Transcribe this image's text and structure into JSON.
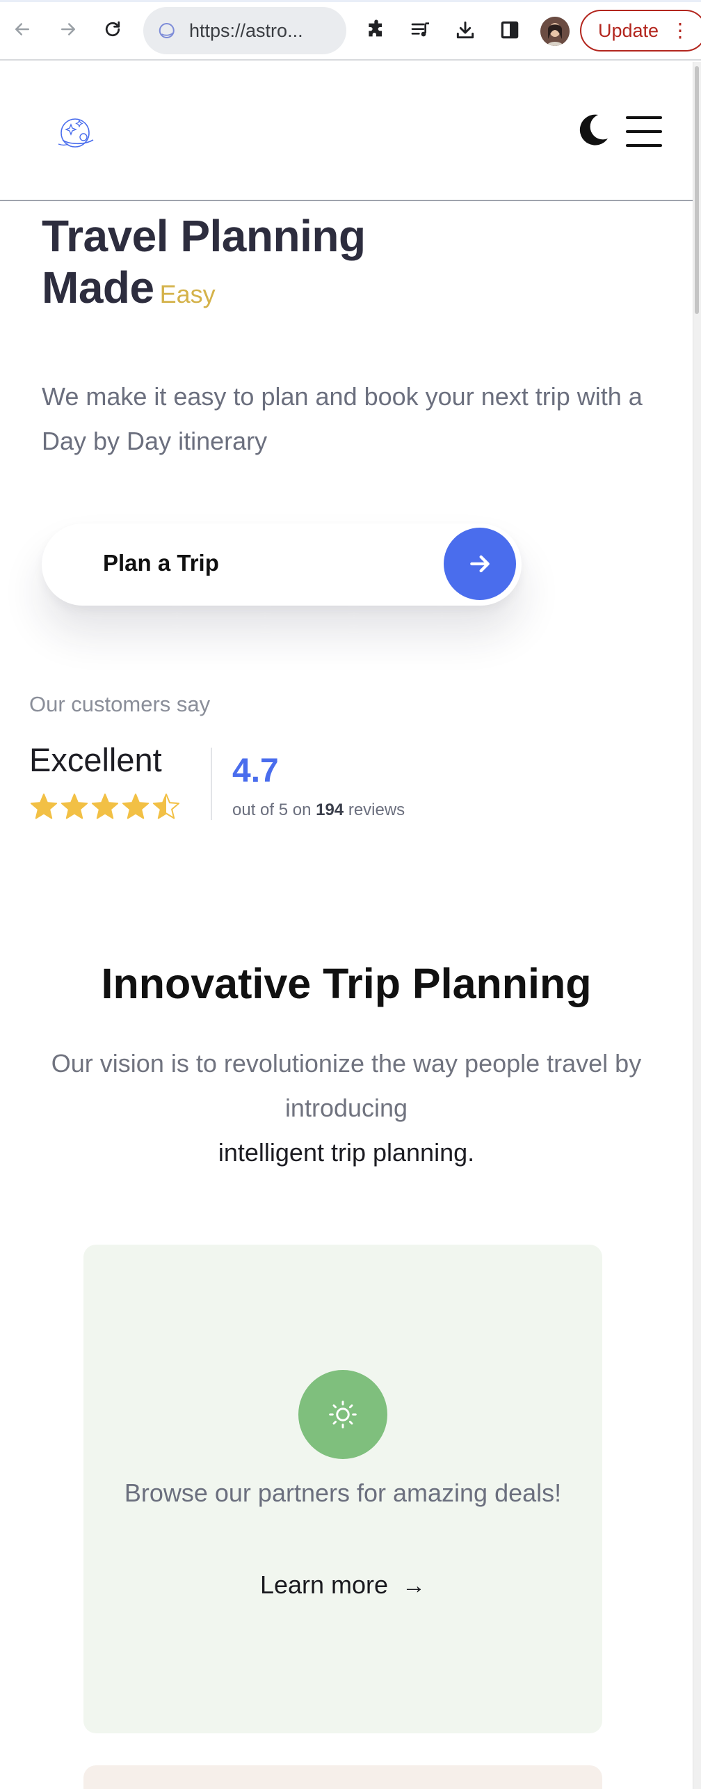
{
  "browser": {
    "url": "https://astro...",
    "update_label": "Update",
    "menu_dots": "⋮"
  },
  "hero": {
    "title_line1": "Travel Planning",
    "title_line2": "Made",
    "title_accent": "Easy",
    "subtitle": "We make it easy to plan and book your next trip with a Day by Day itinerary",
    "cta_label": "Plan a Trip"
  },
  "reviews": {
    "heading": "Our customers say",
    "verdict": "Excellent",
    "rating": "4.7",
    "stars_value": 4.5,
    "detail_prefix": "out of 5 on",
    "count": "194",
    "detail_suffix": "reviews"
  },
  "section": {
    "title": "Innovative Trip Planning",
    "description": "Our vision is to revolutionize the way people travel by introducing",
    "emphasis": "intelligent trip planning."
  },
  "card": {
    "text": "Browse our partners for amazing deals!",
    "link_label": "Learn more",
    "link_arrow": "→"
  },
  "colors": {
    "accent_blue": "#4a6ded",
    "accent_gold": "#d4b24a",
    "card_green": "#7fbf7d",
    "update_red": "#b3261e"
  }
}
